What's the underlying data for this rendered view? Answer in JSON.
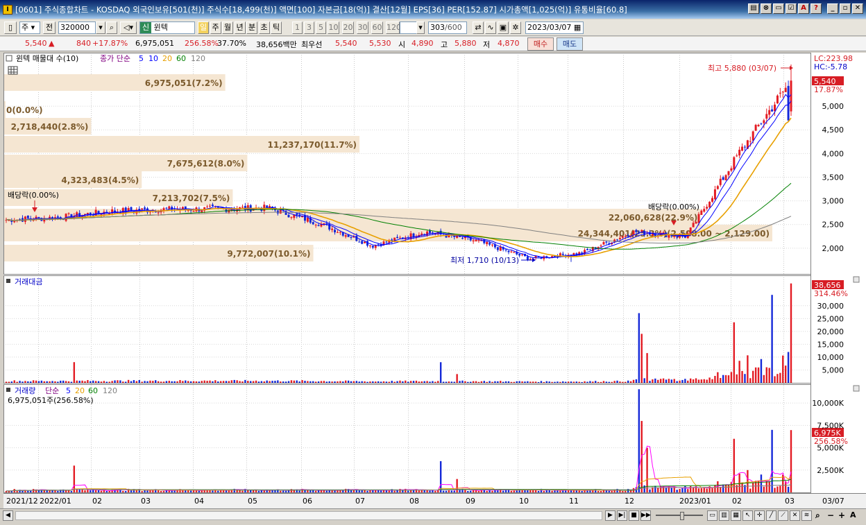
{
  "window": {
    "title": "[0601] 주식종합차트 - KOSDAQ 외국인보유[501(천)] 주식수[18,499(천)] 액면[100] 자본금[18(억)] 결산[12월] EPS[36] PER[152.87] 시가총액[1,025(억)] 유통비율[60.8]",
    "icons": [
      "layout-icon",
      "link-icon",
      "window-icon",
      "check-icon",
      "a-icon",
      "help-icon",
      "minimize-icon",
      "restore-icon",
      "close-icon"
    ]
  },
  "toolbar": {
    "market": "주",
    "prev": "전",
    "code": "320000",
    "stock_badge": "신",
    "stock_name": "윈텍",
    "periods": [
      "일",
      "주",
      "월",
      "년",
      "분",
      "초",
      "틱"
    ],
    "active_period": "일",
    "intervals": [
      "1",
      "3",
      "5",
      "10",
      "20",
      "30",
      "60",
      "120"
    ],
    "count": "303",
    "count_max": "/600",
    "date": "2023/03/07"
  },
  "info": {
    "price": "5,540",
    "arrow": "▲",
    "change": "840",
    "change_pct": "+17.87%",
    "volume": "6,975,051",
    "volume_ratio": "256.58%",
    "turnover": "37.70%",
    "amount": "38,656백만",
    "best_label": "최우선",
    "ask": "5,540",
    "bid": "5,530",
    "open_label": "시",
    "open": "4,890",
    "high_label": "고",
    "high": "5,880",
    "low_label": "저",
    "low": "4,870",
    "buy": "매수",
    "sell": "매도"
  },
  "price_panel": {
    "legend_name": "윈텍 매물대 수(10)",
    "ma_label": "종가 단순",
    "ma_periods": [
      "5",
      "10",
      "20",
      "60",
      "120"
    ],
    "ma_colors": [
      "#0000ff",
      "#0000ff",
      "#e8a000",
      "#008000",
      "#808080"
    ],
    "lc_label": "LC:223.98",
    "hc_label": "HC:-5.78",
    "current_price": "5,540",
    "current_pct": "17.87%",
    "y_ticks": [
      "5,000",
      "4,500",
      "4,000",
      "3,500",
      "3,000",
      "2,500",
      "2,000"
    ],
    "volume_profile": [
      {
        "label": "6,975,051(7.2%)",
        "len": 6975051
      },
      {
        "label": "0(0.0%)",
        "len": 0
      },
      {
        "label": "2,718,440(2.8%)",
        "len": 2718440
      },
      {
        "label": "11,237,170(11.7%)",
        "len": 11237170
      },
      {
        "label": "7,675,612(8.0%)",
        "len": 7675612
      },
      {
        "label": "4,323,483(4.5%)",
        "len": 4323483
      },
      {
        "label": "7,213,702(7.5%)",
        "len": 7213702
      },
      {
        "label": "22,060,628(22.9%)",
        "len": 22060628
      },
      {
        "label": "24,344,401(25.3%)(2,508.00 ~ 2,129.00)",
        "len": 24344401
      },
      {
        "label": "9,772,007(10.1%)",
        "len": 9772007
      }
    ],
    "high_annotation": "최고 5,880 (03/07)",
    "low_annotation": "최저 1,710 (10/13)",
    "dividend_1": "배당락(0.00%)",
    "dividend_2": "배당락(0.00%)"
  },
  "amount_panel": {
    "title": "거래대금",
    "value": "38,656",
    "pct": "314.46%",
    "y_ticks": [
      "30,000",
      "25,000",
      "20,000",
      "15,000",
      "10,000",
      "5,000"
    ]
  },
  "volume_panel": {
    "title": "거래량",
    "ma_label": "단순",
    "ma_periods": [
      "5",
      "20",
      "60",
      "120"
    ],
    "subtitle": "6,975,051주(256.58%)",
    "value": "6,975K",
    "pct": "256.58%",
    "y_ticks": [
      "10,000K",
      "7,500K",
      "5,000K",
      "2,500K"
    ]
  },
  "x_axis": [
    "2021/12",
    "2022/01",
    "02",
    "03",
    "04",
    "05",
    "06",
    "07",
    "08",
    "09",
    "10",
    "11",
    "12",
    "2023/01",
    "02",
    "03",
    "03/07"
  ],
  "chart_data": {
    "type": "candlestick",
    "ylim": [
      1500,
      6100
    ],
    "ma_periods": [
      5,
      10,
      20,
      60,
      120
    ],
    "dates": [
      "2021/12",
      "2022/01",
      "02",
      "03",
      "04",
      "05",
      "06",
      "07",
      "08",
      "09",
      "10",
      "11",
      "12",
      "2023/01",
      "02",
      "03"
    ],
    "price_anchors": [
      2600,
      2650,
      2780,
      2820,
      2830,
      2850,
      2520,
      2050,
      2350,
      2150,
      1780,
      1900,
      2350,
      2250,
      4000,
      5540
    ],
    "last_close": 5540,
    "high": 5880,
    "low": 1710
  }
}
